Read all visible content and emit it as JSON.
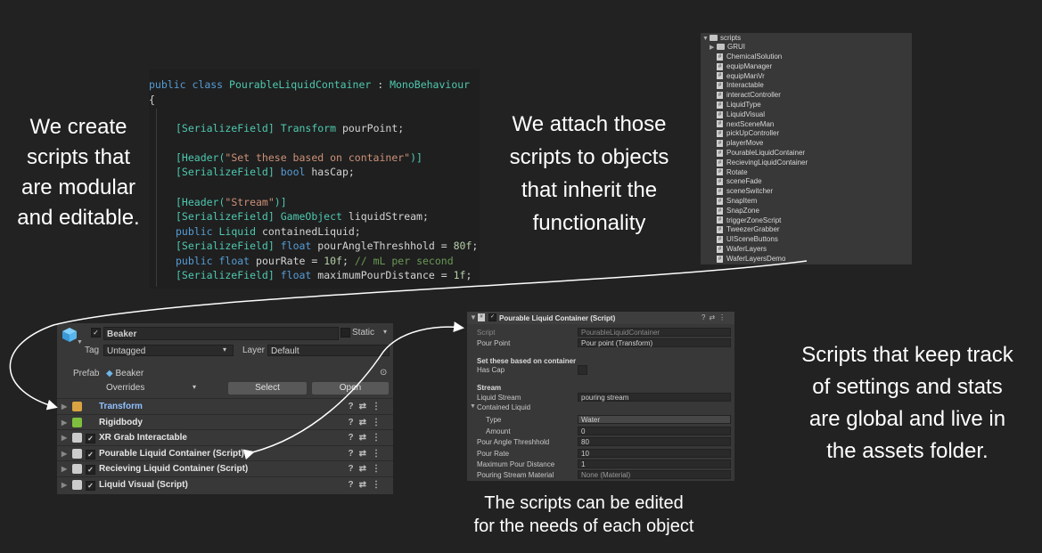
{
  "captions": {
    "left": [
      "We create",
      "scripts that",
      "are modular",
      "and editable."
    ],
    "middle": [
      "We attach those",
      "scripts to objects",
      "that inherit the",
      "functionality"
    ],
    "right": [
      "Scripts that keep track",
      "of settings and stats",
      "are global and live in",
      "the assets folder."
    ],
    "bottom": [
      "The scripts can be edited",
      "for the needs of each object"
    ]
  },
  "code": {
    "class_line": {
      "kw1": "public",
      "kw2": "class",
      "name": "PourableLiquidContainer",
      "sep": " : ",
      "base": "MonoBehaviour"
    },
    "brace": "{",
    "l1": {
      "attr": "[SerializeField]",
      "type": "Transform",
      "rest": " pourPoint;"
    },
    "l2": {
      "pre": "[Header(",
      "str": "\"Set these based on container\"",
      "post": ")]"
    },
    "l3": {
      "attr": "[SerializeField]",
      "type": "bool",
      "rest": " hasCap;"
    },
    "l4": {
      "pre": "[Header(",
      "str": "\"Stream\"",
      "post": ")]"
    },
    "l5": {
      "attr": "[SerializeField]",
      "type": "GameObject",
      "rest": " liquidStream;"
    },
    "l6": {
      "kw": "public",
      "type": "Liquid",
      "rest": " containedLiquid;"
    },
    "l7": {
      "attr": "[SerializeField]",
      "type": "float",
      "rest": " pourAngleThreshhold = ",
      "num": "80f",
      "end": ";"
    },
    "l8": {
      "kw": "public",
      "type": "float",
      "rest": " pourRate = ",
      "num": "10f",
      "end": "; ",
      "comment": "// mL per second"
    },
    "l9": {
      "attr": "[SerializeField]",
      "type": "float",
      "rest": " maximumPourDistance = ",
      "num": "1f",
      "end": ";"
    }
  },
  "tree": {
    "root": "scripts",
    "folder": "GRUI",
    "items": [
      "ChemicalSolution",
      "equipManager",
      "equipManVr",
      "Interactable",
      "interactController",
      "LiquidType",
      "LiquidVisual",
      "nextSceneMan",
      "pickUpController",
      "playerMove",
      "PourableLiquidContainer",
      "RecievingLiquidContainer",
      "Rotate",
      "sceneFade",
      "sceneSwitcher",
      "SnapItem",
      "SnapZone",
      "triggerZoneScript",
      "TweezerGrabber",
      "UISceneButtons",
      "WaferLayers",
      "WaferLayersDemo"
    ]
  },
  "inspector": {
    "name": "Beaker",
    "static_label": "Static",
    "tag_label": "Tag",
    "tag_value": "Untagged",
    "layer_label": "Layer",
    "layer_value": "Default",
    "prefab_label": "Prefab",
    "prefab_value": "Beaker",
    "overrides": "Overrides",
    "select": "Select",
    "open": "Open",
    "components": [
      {
        "name": "Transform",
        "icon_color": "#d9a441"
      },
      {
        "name": "Rigidbody",
        "icon_color": "#7fbf3f"
      },
      {
        "name": "XR Grab Interactable",
        "icon_color": "#cccccc"
      },
      {
        "name": "Pourable Liquid Container (Script)",
        "icon_color": "#cccccc"
      },
      {
        "name": "Recieving Liquid Container (Script)",
        "icon_color": "#cccccc"
      },
      {
        "name": "Liquid Visual (Script)",
        "icon_color": "#cccccc"
      }
    ]
  },
  "script_inspector": {
    "title": "Pourable Liquid Container (Script)",
    "script_label": "Script",
    "script_value": "PourableLiquidContainer",
    "pour_point_label": "Pour Point",
    "pour_point_value": "Pour point (Transform)",
    "header1": "Set these based on container",
    "has_cap_label": "Has Cap",
    "header2": "Stream",
    "liquid_stream_label": "Liquid Stream",
    "liquid_stream_value": "pouring stream",
    "contained_liquid_label": "Contained Liquid",
    "type_label": "Type",
    "type_value": "Water",
    "amount_label": "Amount",
    "amount_value": "0",
    "angle_label": "Pour Angle Threshhold",
    "angle_value": "80",
    "rate_label": "Pour Rate",
    "rate_value": "10",
    "max_label": "Maximum Pour Distance",
    "max_value": "1",
    "material_label": "Pouring Stream Material",
    "material_value": "None (Material)"
  }
}
